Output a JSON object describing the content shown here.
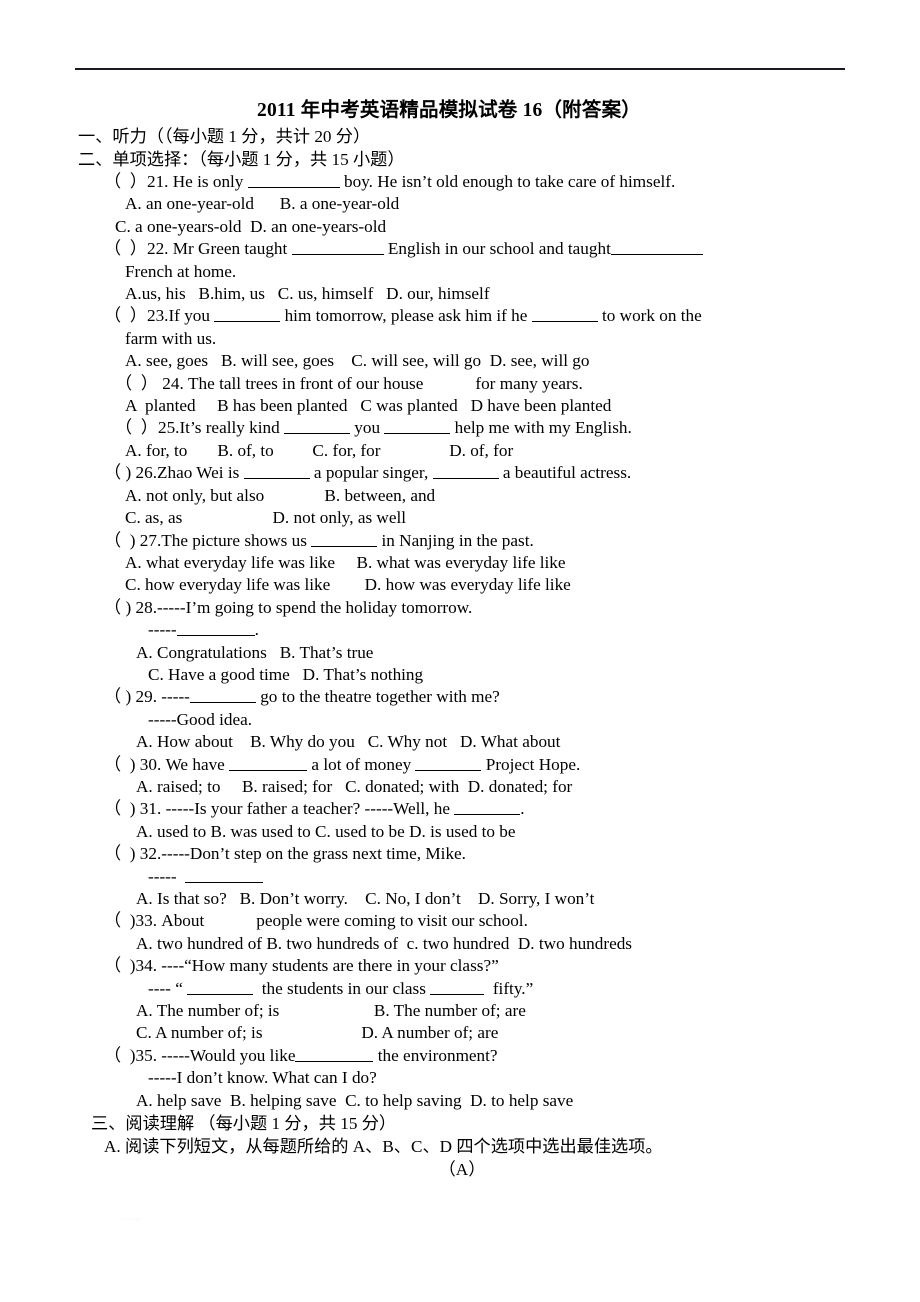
{
  "document": {
    "title": "2011 年中考英语精品模拟试卷 16（附答案）",
    "watermark": "······"
  },
  "sections": {
    "listening": "一、听力（（每小题 1 分，共计 20 分）",
    "multiple_choice": "二、单项选择：（每小题 1 分，共 15 小题）",
    "reading": "三、阅读理解 （每小题 1 分，共 15 分）",
    "reading_instruction": "A. 阅读下列短文，从每题所给的 A、B、C、D 四个选项中选出最佳选项。",
    "passage_label": "（A）"
  },
  "questions": [
    {
      "id": "q21",
      "stem_pre": "（  ）21. He is only ",
      "stem_post": " boy. He isn’t old enough to take care of himself.",
      "blank": "xl",
      "options": [
        {
          "indent": "i2",
          "text": "A. an one-year-old      B. a one-year-old"
        },
        {
          "indent": "i1",
          "text": "C. a one-years-old  D. an one-years-old"
        }
      ]
    },
    {
      "id": "q22",
      "stem_pre": "（  ）22. Mr Green taught ",
      "stem_mid": " English in our school and taught",
      "blank": "xl",
      "blank2": "xl",
      "continuation": "French at home.",
      "options": [
        {
          "indent": "i1",
          "text": "A.us, his   B.him, us   C. us, himself   D. our, himself"
        }
      ]
    },
    {
      "id": "q23",
      "stem_pre": "（  ）23.If you ",
      "stem_mid": " him tomorrow, please ask him if he ",
      "stem_post": " to work on the",
      "blank": "m",
      "blank2": "m",
      "continuation": "farm with us.",
      "options": [
        {
          "indent": "i2",
          "text": "A. see, goes   B. will see, goes    C. will see, will go  D. see, will go"
        }
      ]
    },
    {
      "id": "q24",
      "stem_pre": "（  ） 24. The tall trees in front of our house",
      "stem_post": "for many years.",
      "blank": "gap",
      "options": [
        {
          "indent": "i2",
          "text": "A  planted     B has been planted   C was planted   D have been planted"
        }
      ]
    },
    {
      "id": "q25",
      "stem_pre": "（  ）25.It’s really kind ",
      "stem_mid": " you ",
      "stem_post": " help me with my English.",
      "blank": "m",
      "blank2": "m",
      "options": [
        {
          "indent": "i1",
          "text": "A. for, to       B. of, to         C. for, for                D. of, for"
        }
      ]
    },
    {
      "id": "q26",
      "stem_pre": "（ ) 26.Zhao Wei is ",
      "stem_mid": " a popular singer, ",
      "stem_post": " a beautiful actress.",
      "blank": "m",
      "blank2": "m",
      "options": [
        {
          "indent": "i1",
          "text": "A. not only, but also              B. between, and"
        },
        {
          "indent": "i1",
          "text": "C. as, as                     D. not only, as well"
        }
      ]
    },
    {
      "id": "q27",
      "stem_pre": "（  ) 27.The picture shows us ",
      "stem_post": " in Nanjing in the past.",
      "blank": "m",
      "options": [
        {
          "indent": "i1",
          "text": "A. what everyday life was like     B. what was everyday life like"
        },
        {
          "indent": "i1",
          "text": "C. how everyday life was like        D. how was everyday life like"
        }
      ]
    },
    {
      "id": "q28",
      "stem_pre": "（ ) 28.-----I’m going to spend the holiday tomorrow.",
      "sub_line_pre": "-----",
      "sub_line_post": ".",
      "blank": "l",
      "options": [
        {
          "indent": "i2",
          "text": "A. Congratulations   B. That’s true"
        },
        {
          "indent": "i3",
          "text": "C. Have a good time   D. That’s nothing"
        }
      ]
    },
    {
      "id": "q29",
      "stem_pre": "（ ) 29. -----",
      "stem_post": " go to the theatre together with me?",
      "blank": "m",
      "continuation": "-----Good idea.",
      "options": [
        {
          "indent": "i3",
          "text": "A. How about    B. Why do you   C. Why not   D. What about"
        }
      ]
    },
    {
      "id": "q30",
      "stem_pre": "（  ) 30. We have ",
      "stem_mid": " a lot of money ",
      "stem_post": " Project Hope.",
      "blank": "l",
      "blank2": "m",
      "options": [
        {
          "indent": "i3",
          "text": "A. raised; to     B. raised; for   C. donated; with  D. donated; for"
        }
      ]
    },
    {
      "id": "q31",
      "stem_pre": "（  ) 31. -----Is your father a teacher? -----Well, he ",
      "stem_post": ".",
      "blank": "m",
      "options": [
        {
          "indent": "i3",
          "text": "A. used to B. was used to C. used to be D. is used to be"
        }
      ]
    },
    {
      "id": "q32",
      "stem_pre": "（  ) 32.-----Don’t step on the grass next time, Mike.",
      "sub_line_pre": "-----  ",
      "sub_line_post": "",
      "blank": "l",
      "options": [
        {
          "indent": "i3",
          "text": "A. Is that so?   B. Don’t worry.    C. No, I don’t    D. Sorry, I won’t"
        }
      ]
    },
    {
      "id": "q33",
      "stem_pre": "（  )33. About",
      "stem_post": "people were coming to visit our school.",
      "blank": "gap",
      "options": [
        {
          "indent": "i3",
          "text": "A. two hundred of B. two hundreds of  c. two hundred  D. two hundreds"
        }
      ]
    },
    {
      "id": "q34",
      "stem_pre": "（  )34. ----“How many students are there in your class?”",
      "sub_line_pre": "---- “ ",
      "sub_line_mid": "  the students in our class ",
      "sub_line_post": "  fifty.”",
      "blank": "m",
      "blank2": "s",
      "options": [
        {
          "indent": "i3",
          "text": "A. The number of; is                      B. The number of; are"
        },
        {
          "indent": "i3",
          "text": "C. A number of; is                       D. A number of; are"
        }
      ]
    },
    {
      "id": "q35",
      "stem_pre": "（  )35. -----Would you like",
      "stem_post": " the environment?",
      "blank": "l",
      "continuation": "-----I don’t know. What can I do?",
      "options": [
        {
          "indent": "i3",
          "text": "A. help save  B. helping save  C. to help saving  D. to help save"
        }
      ]
    }
  ]
}
